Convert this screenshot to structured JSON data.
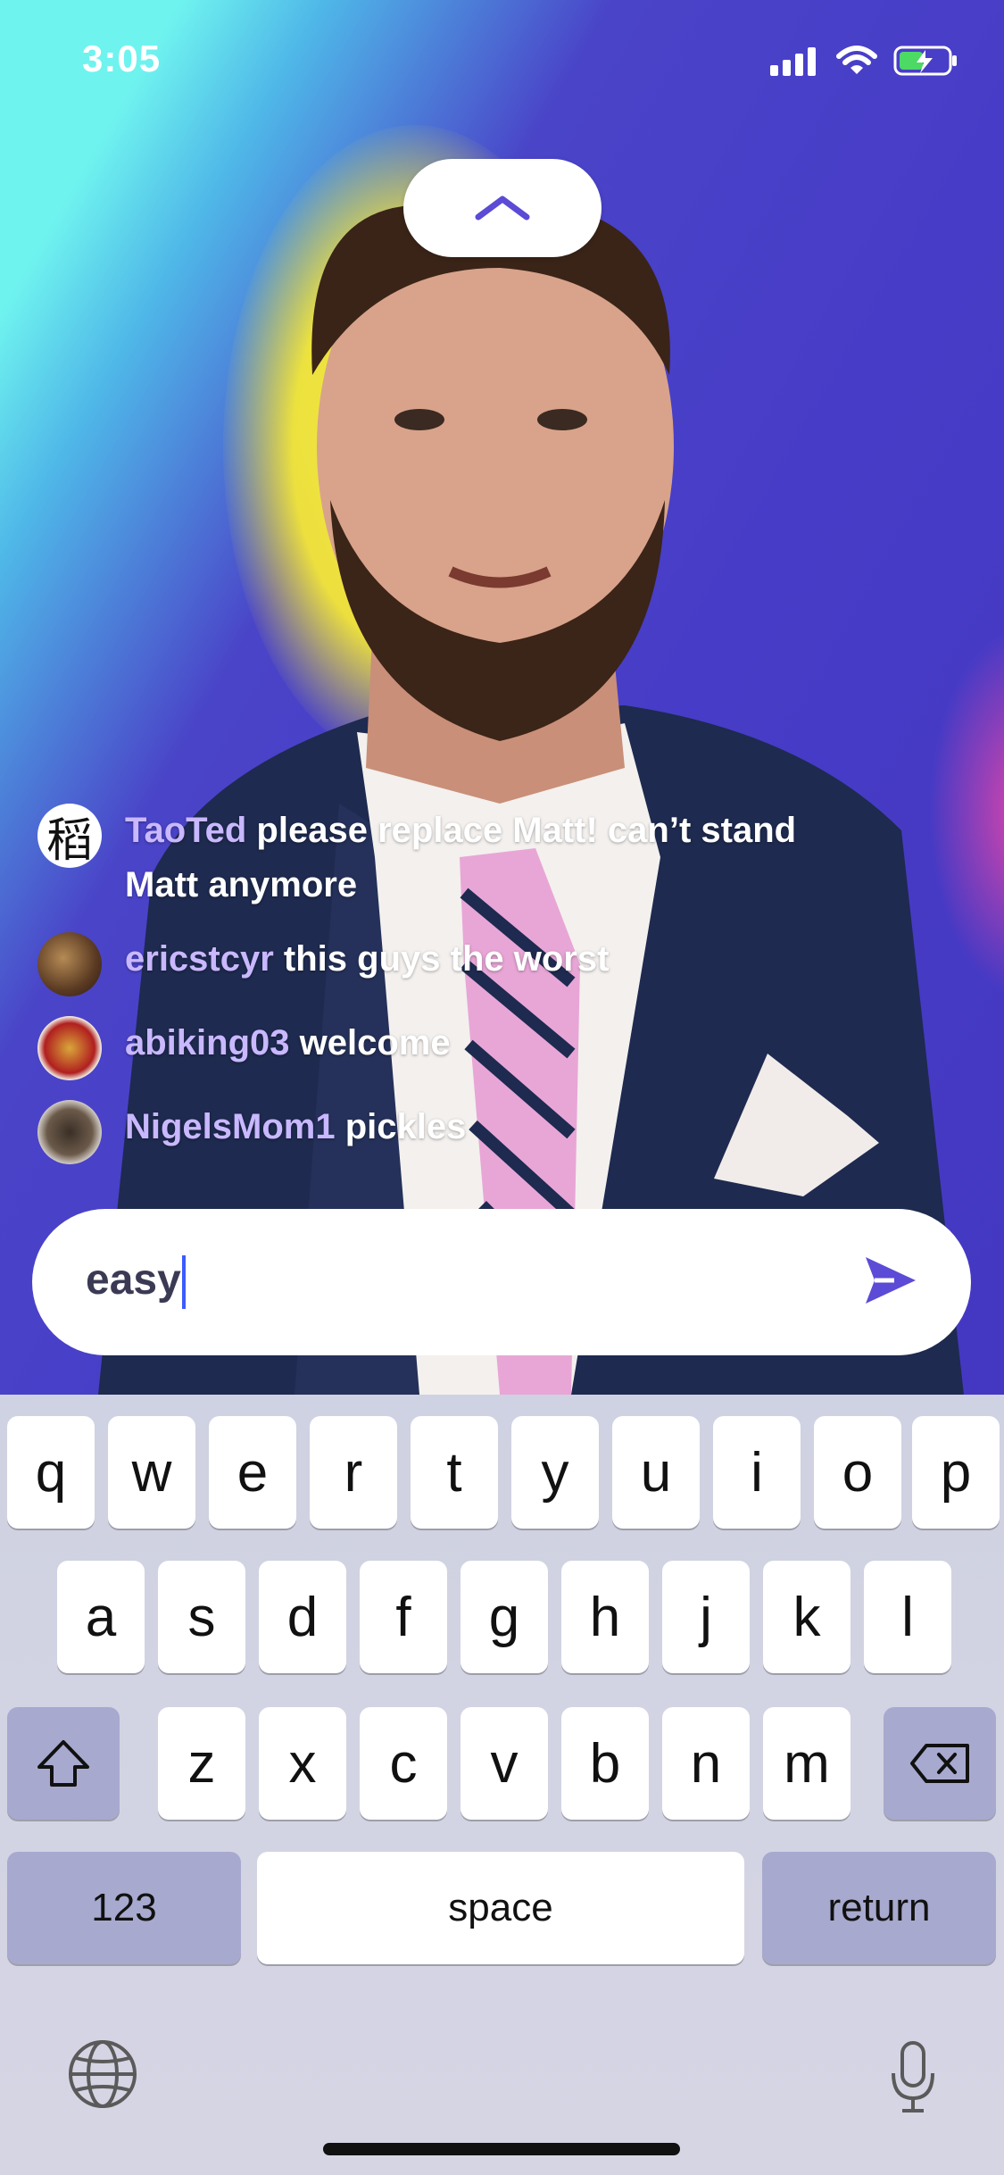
{
  "status_bar": {
    "time": "3:05"
  },
  "chat": {
    "messages": [
      {
        "user": "TaoTed",
        "text": "please replace Matt! can’t stand Matt anymore"
      },
      {
        "user": "ericstcyr",
        "text": "this guys the worst"
      },
      {
        "user": "abiking03",
        "text": "welcome"
      },
      {
        "user": "NigelsMom1",
        "text": "pickles"
      }
    ],
    "avatar_glyph": "稻"
  },
  "input": {
    "value": "easy"
  },
  "keyboard": {
    "row1": [
      "q",
      "w",
      "e",
      "r",
      "t",
      "y",
      "u",
      "i",
      "o",
      "p"
    ],
    "row2": [
      "a",
      "s",
      "d",
      "f",
      "g",
      "h",
      "j",
      "k",
      "l"
    ],
    "row3": [
      "z",
      "x",
      "c",
      "v",
      "b",
      "n",
      "m"
    ],
    "numbers_label": "123",
    "space_label": "space",
    "return_label": "return"
  },
  "icons": {
    "collapse": "chevron-up-icon",
    "send": "send-icon",
    "shift": "shift-icon",
    "delete": "backspace-icon",
    "globe": "globe-icon",
    "mic": "microphone-icon"
  },
  "colors": {
    "accent": "#5b4bd6",
    "username": "#c9b8ff"
  }
}
